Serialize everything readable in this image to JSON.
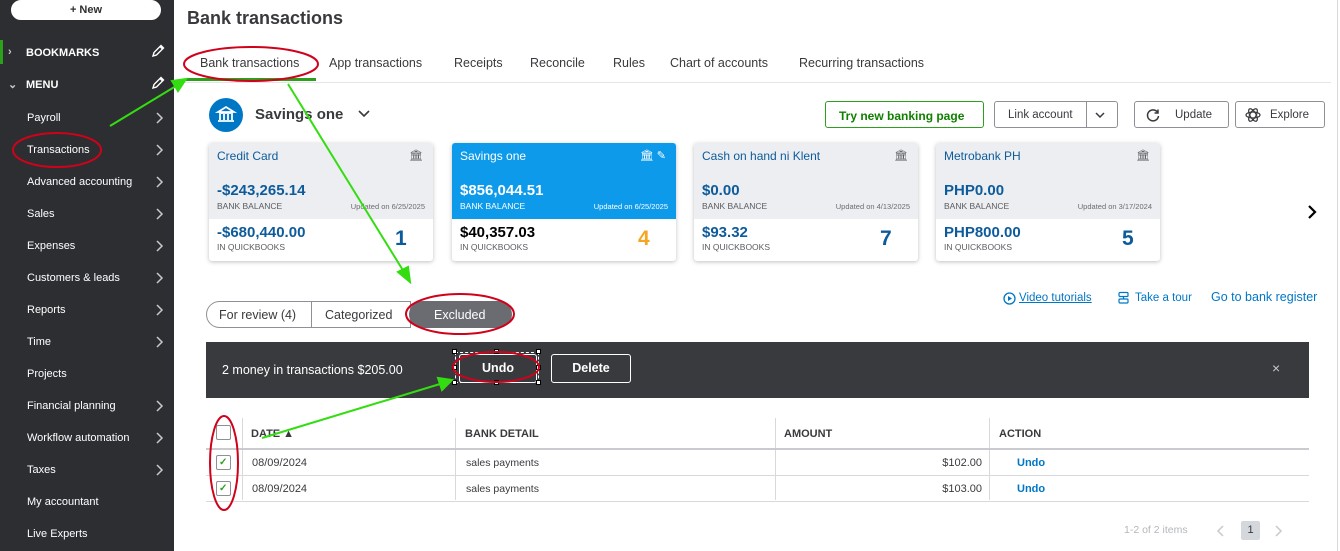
{
  "sidebar": {
    "new_label": "+ New",
    "bookmarks_label": "BOOKMARKS",
    "menu_label": "MENU",
    "items": [
      {
        "label": "Payroll",
        "has_arrow": true
      },
      {
        "label": "Transactions",
        "has_arrow": true
      },
      {
        "label": "Advanced accounting",
        "has_arrow": true
      },
      {
        "label": "Sales",
        "has_arrow": true
      },
      {
        "label": "Expenses",
        "has_arrow": true
      },
      {
        "label": "Customers & leads",
        "has_arrow": true
      },
      {
        "label": "Reports",
        "has_arrow": true
      },
      {
        "label": "Time",
        "has_arrow": true
      },
      {
        "label": "Projects",
        "has_arrow": false
      },
      {
        "label": "Financial planning",
        "has_arrow": true
      },
      {
        "label": "Workflow automation",
        "has_arrow": true
      },
      {
        "label": "Taxes",
        "has_arrow": true
      },
      {
        "label": "My accountant",
        "has_arrow": false
      },
      {
        "label": "Live Experts",
        "has_arrow": false
      }
    ]
  },
  "header": {
    "title": "Bank transactions",
    "tabs": [
      "Bank transactions",
      "App transactions",
      "Receipts",
      "Reconcile",
      "Rules",
      "Chart of accounts",
      "Recurring transactions"
    ]
  },
  "account": {
    "name": "Savings one",
    "try_new_label": "Try new banking page",
    "link_account_label": "Link account",
    "update_label": "Update",
    "explore_label": "Explore"
  },
  "cards": [
    {
      "name": "Credit Card",
      "bank_balance": "-$243,265.14",
      "bank_label": "BANK BALANCE",
      "updated": "Updated on 6/25/2025",
      "qb_balance": "-$680,440.00",
      "qb_label": "IN QUICKBOOKS",
      "count": "1",
      "selected": false
    },
    {
      "name": "Savings one",
      "bank_balance": "$856,044.51",
      "bank_label": "BANK BALANCE",
      "updated": "Updated on 6/25/2025",
      "qb_balance": "$40,357.03",
      "qb_label": "IN QUICKBOOKS",
      "count": "4",
      "selected": true
    },
    {
      "name": "Cash on hand ni Klent",
      "bank_balance": "$0.00",
      "bank_label": "BANK BALANCE",
      "updated": "Updated on 4/13/2025",
      "qb_balance": "$93.32",
      "qb_label": "IN QUICKBOOKS",
      "count": "7",
      "selected": false
    },
    {
      "name": "Metrobank PH",
      "bank_balance": "PHP0.00",
      "bank_label": "BANK BALANCE",
      "updated": "Updated on 3/17/2024",
      "qb_balance": "PHP800.00",
      "qb_label": "IN QUICKBOOKS",
      "count": "5",
      "selected": false
    }
  ],
  "filters": {
    "for_review": "For review (4)",
    "categorized": "Categorized",
    "excluded": "Excluded",
    "video_tutorials": "Video tutorials",
    "take_tour": "Take a tour",
    "go_register": "Go to bank register"
  },
  "action_bar": {
    "message": "2 money in transactions $205.00",
    "undo_label": "Undo",
    "delete_label": "Delete",
    "close_glyph": "×"
  },
  "table": {
    "headers": {
      "date": "DATE ▲",
      "bank_detail": "BANK DETAIL",
      "amount": "AMOUNT",
      "action": "ACTION"
    },
    "rows": [
      {
        "date": "08/09/2024",
        "bank_detail": "sales payments",
        "amount": "$102.00",
        "action": "Undo",
        "checked": true
      },
      {
        "date": "08/09/2024",
        "bank_detail": "sales payments",
        "amount": "$103.00",
        "action": "Undo",
        "checked": true
      }
    ]
  },
  "pager": {
    "summary": "1-2 of 2 items",
    "page": "1"
  },
  "colors": {
    "accent_green": "#2ca01c",
    "brand_blue": "#0077c5",
    "selected_card": "#0d9aea",
    "annotation_red": "#d0021b",
    "annotation_arrow": "#33dd11"
  }
}
